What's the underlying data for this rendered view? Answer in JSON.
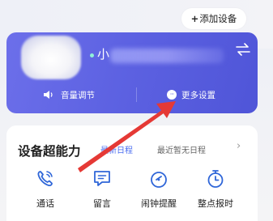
{
  "header": {
    "add_device_plus": "+",
    "add_device_label": "添加设备"
  },
  "device": {
    "name_visible": "小",
    "swap_icon": "swap-arrows-icon",
    "status_color": "#8ff0d8",
    "actions": {
      "volume_label": "音量调节",
      "more_label": "更多设置",
      "more_glyph": "···"
    },
    "card_color": "#5d62e2"
  },
  "capabilities": {
    "title": "设备超能力",
    "schedule_tab": "最新日程",
    "schedule_status": "最近暂无日程",
    "chevron": "›",
    "items": [
      {
        "label": "通话",
        "icon": "phone-icon"
      },
      {
        "label": "留言",
        "icon": "message-icon"
      },
      {
        "label": "闹钟提醒",
        "icon": "alarm-icon"
      },
      {
        "label": "整点报时",
        "icon": "hourly-chime-icon"
      }
    ]
  },
  "annotation": {
    "arrow_color": "#e53935"
  }
}
